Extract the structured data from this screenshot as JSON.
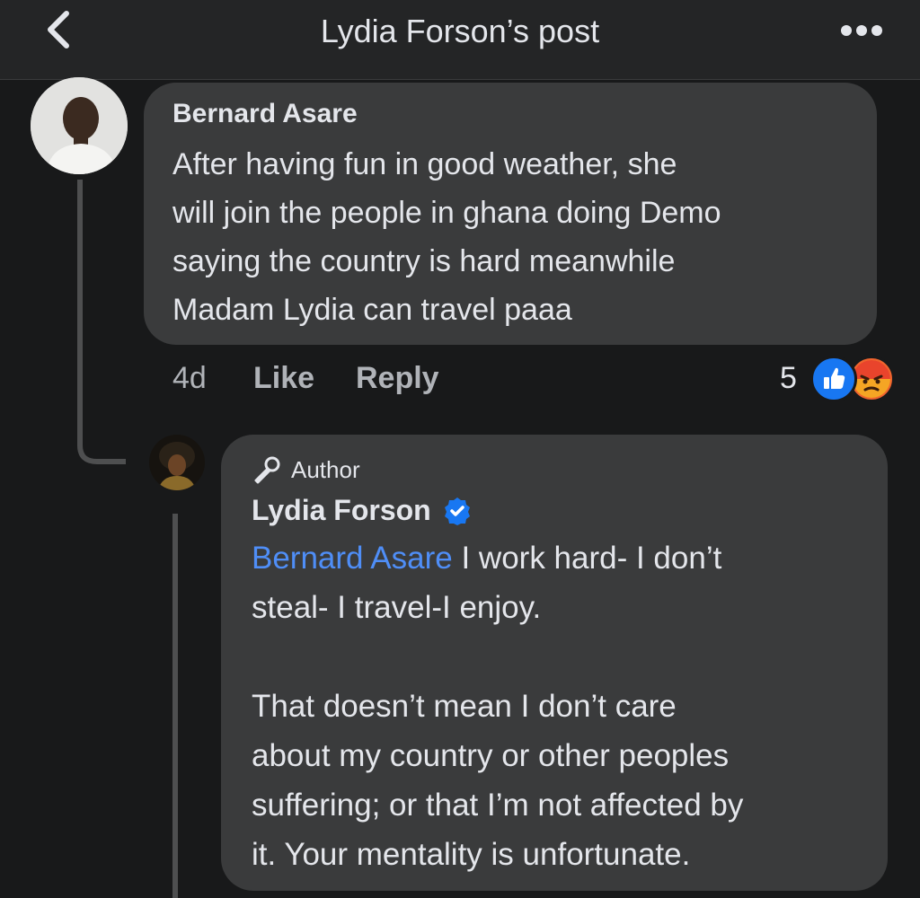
{
  "header": {
    "title": "Lydia Forson’s post",
    "back_icon": "chevron-left-icon",
    "more_icon": "more-horizontal-icon"
  },
  "comment": {
    "author": "Bernard Asare",
    "avatar_icon": "user-avatar",
    "text": "After having fun in good weather, she\nwill join the people in ghana doing Demo\nsaying the country is hard meanwhile\nMadam Lydia can travel paaa",
    "time": "4d",
    "like_label": "Like",
    "reply_label": "Reply",
    "reaction_count": "5",
    "reactions": [
      "like-reaction-icon",
      "angry-reaction-icon"
    ]
  },
  "reply": {
    "badge_icon": "microphone-icon",
    "badge_label": "Author",
    "author": "Lydia Forson",
    "verified_icon": "verified-badge-icon",
    "mention": "Bernard Asare",
    "text_after_mention": " I work hard- I don’t\nsteal- I travel-I enjoy.\n\nThat doesn’t mean I don’t care\nabout my country or other peoples\nsuffering; or that I’m not affected by\nit. Your mentality is unfortunate."
  },
  "colors": {
    "background": "#18191a",
    "bubble": "#3a3b3c",
    "text": "#e4e6eb",
    "secondary_text": "#b0b3b8",
    "mention": "#4f8ef7",
    "like_blue": "#1877f2",
    "angry_orange": "#f0642e"
  }
}
